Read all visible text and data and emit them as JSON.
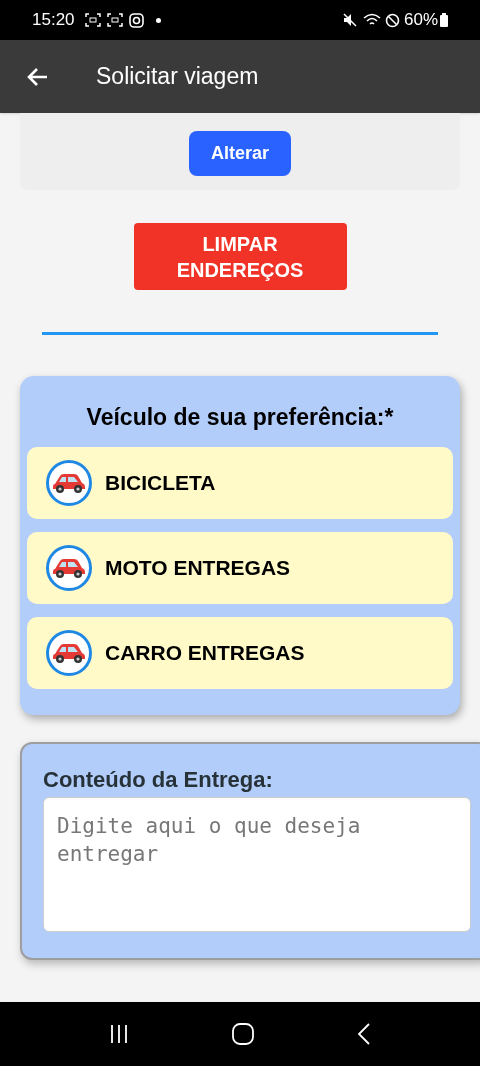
{
  "status_bar": {
    "time": "15:20",
    "battery": "60%"
  },
  "app_bar": {
    "title": "Solicitar viagem"
  },
  "address_card": {
    "change_button": "Alterar"
  },
  "clear_button": "LIMPAR ENDEREÇOS",
  "vehicle_section": {
    "title": "Veículo de sua preferência:*",
    "options": [
      {
        "label": "BICICLETA"
      },
      {
        "label": "MOTO ENTREGAS"
      },
      {
        "label": "CARRO ENTREGAS"
      }
    ]
  },
  "delivery_content": {
    "label": "Conteúdo da Entrega:",
    "placeholder": "Digite aqui o que deseja entregar"
  }
}
